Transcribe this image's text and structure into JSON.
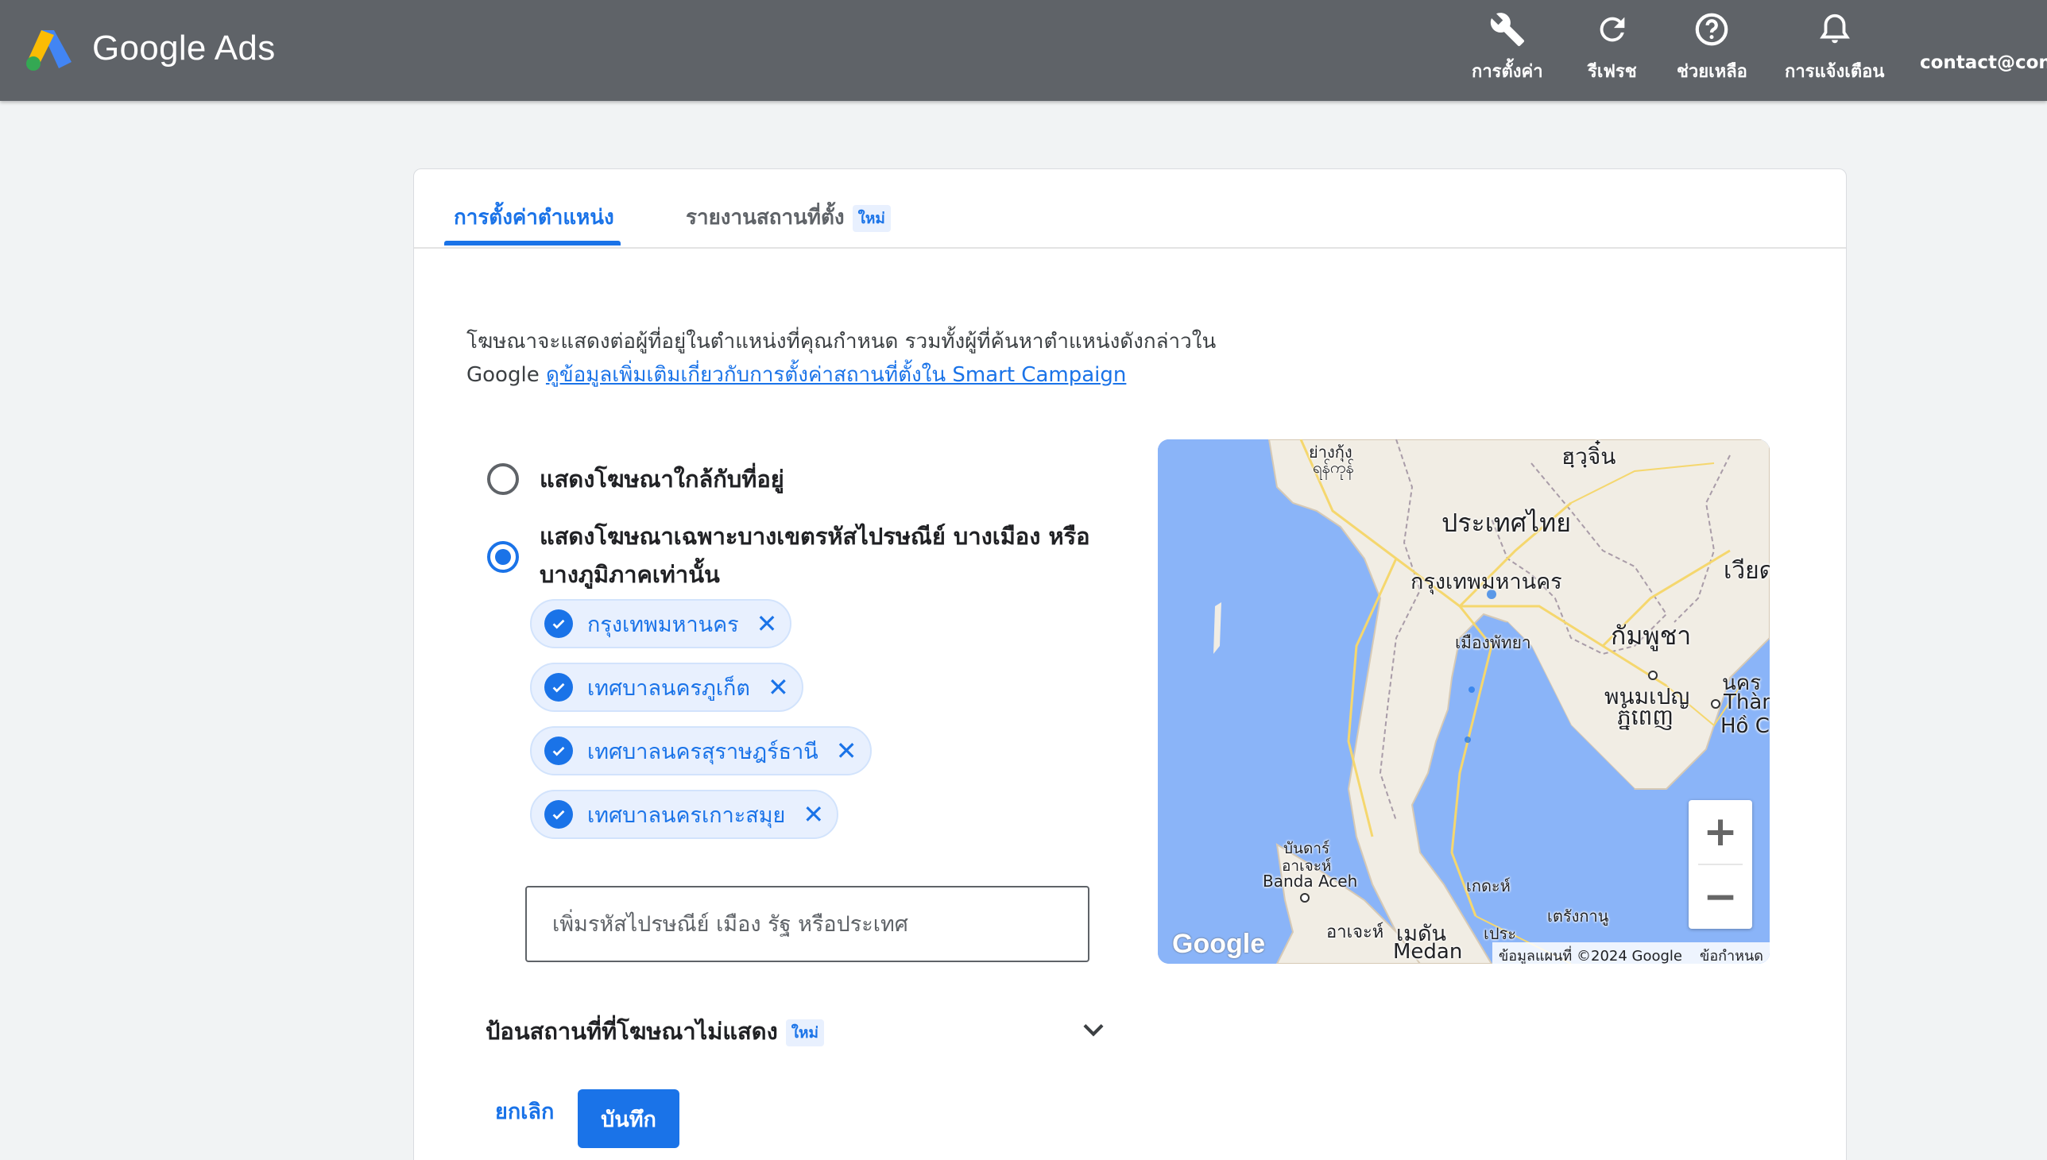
{
  "header": {
    "brand": "Google Ads",
    "actions": [
      {
        "label": "การตั้งค่า",
        "icon": "wrench-icon"
      },
      {
        "label": "รีเฟรช",
        "icon": "refresh-icon"
      },
      {
        "label": "ช่วยเหลือ",
        "icon": "help-icon"
      },
      {
        "label": "การแจ้งเตือน",
        "icon": "bell-icon"
      }
    ],
    "account": "contact@conte"
  },
  "tabs": [
    {
      "label": "การตั้งค่าตำแหน่ง",
      "active": true
    },
    {
      "label": "รายงานสถานที่ตั้ง",
      "badge": "ใหม่"
    }
  ],
  "description": {
    "text_line1": "โฆษณาจะแสดงต่อผู้ที่อยู่ในตำแหน่งที่คุณกำหนด รวมทั้งผู้ที่ค้นหาตำแหน่งดังกล่าวใน",
    "text_line2_prefix": "Google",
    "link": "ดูข้อมูลเพิ่มเติมเกี่ยวกับการตั้งค่าสถานที่ตั้งใน Smart Campaign"
  },
  "options": [
    {
      "label": "แสดงโฆษณาใกล้กับที่อยู่",
      "selected": false
    },
    {
      "label_line1": "แสดงโฆษณาเฉพาะบางเขตรหัสไปรษณีย์ บางเมือง หรือ",
      "label_line2": "บางภูมิภาคเท่านั้น",
      "selected": true
    }
  ],
  "locations": [
    "กรุงเทพมหานคร",
    "เทศบาลนครภูเก็ต",
    "เทศบาลนครสุราษฎร์ธานี",
    "เทศบาลนครเกาะสมุย"
  ],
  "search": {
    "placeholder": "เพิ่มรหัสไปรษณีย์ เมือง รัฐ หรือประเทศ"
  },
  "exclude": {
    "label": "ป้อนสถานที่ที่โฆษณาไม่แสดง",
    "badge": "ใหม่"
  },
  "buttons": {
    "cancel": "ยกเลิก",
    "save": "บันทึก"
  },
  "map": {
    "labels": {
      "yangon_th": "ย่างกุ้ง",
      "yangon_my": "ရန်ကုန်",
      "yunnan": "ฮฺวฺจิ๋น",
      "thailand": "ประเทศไทย",
      "bangkok": "กรุงเทพมหานคร",
      "vietnam": "เวียด",
      "pattaya": "เมืองพัทยา",
      "cambodia": "กัมพูชา",
      "phnompenh_th": "พนมเปญ",
      "phnompenh_km": "ភ្នំពេញ",
      "hcm_th": "นคร",
      "hcm_vi1": "Thàn",
      "hcm_vi2": "Hồ C",
      "banda_th1": "บันดาร์",
      "banda_th2": "อาเจะห์",
      "banda": "Banda Aceh",
      "kedah": "เกดะห์",
      "aceh": "อาเจะห์",
      "medan_th": "เมดัน",
      "medan": "Medan",
      "perak": "เประ",
      "terengganu": "เตรังกานู"
    },
    "logo": "Google",
    "attribution": "ข้อมูลแผนที่ ©2024 Google",
    "terms": "ข้อกำหนด",
    "zoom_in": "+",
    "zoom_out": "−"
  }
}
